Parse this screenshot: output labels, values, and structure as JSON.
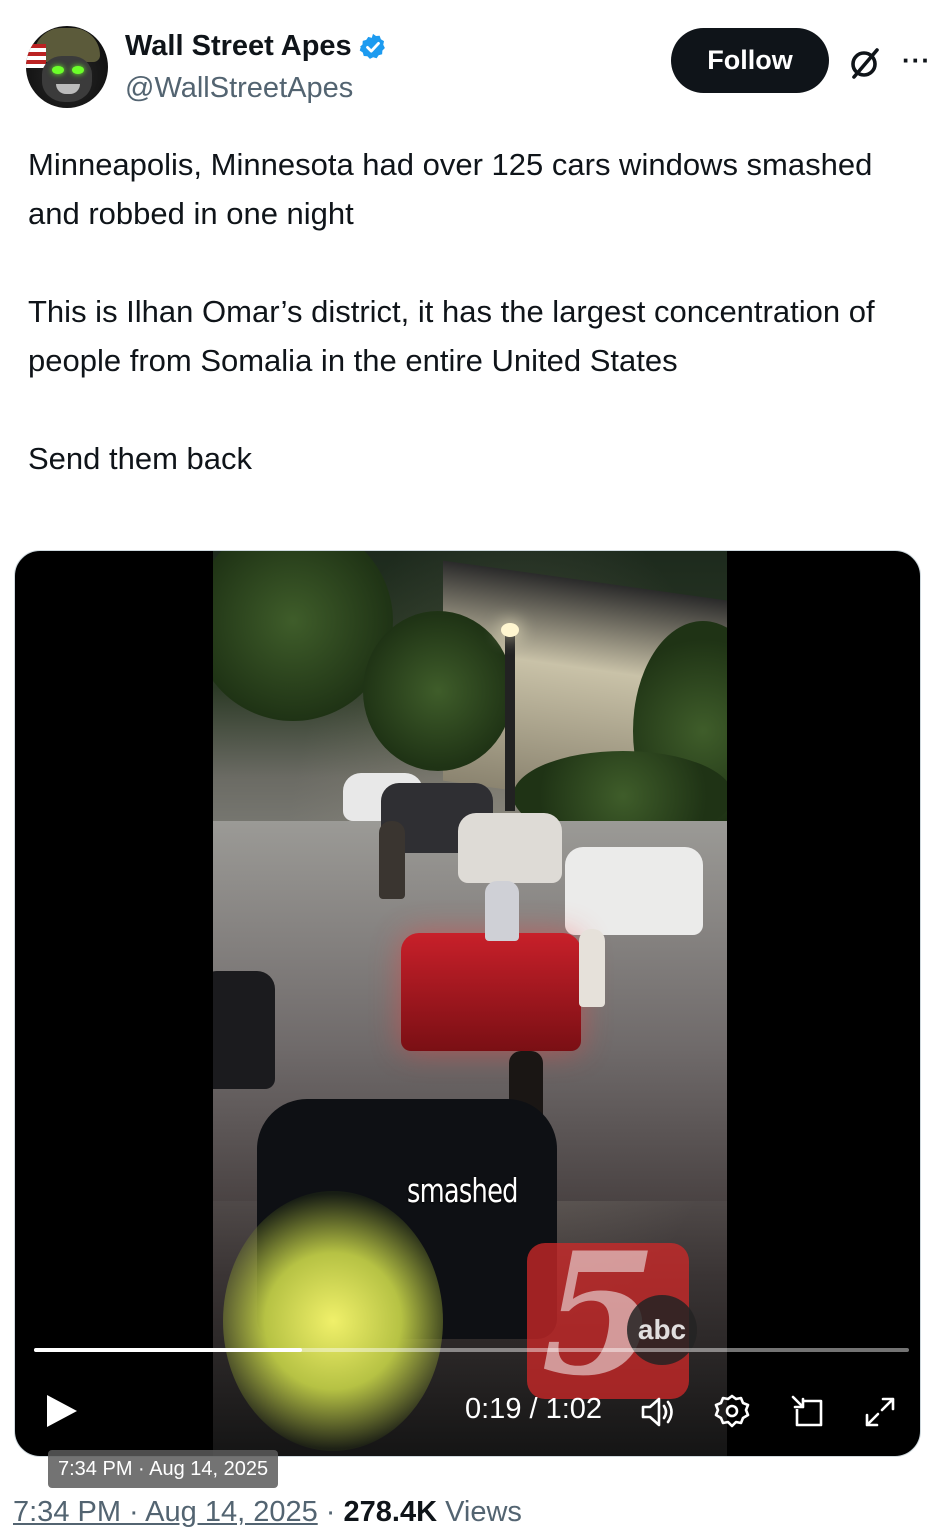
{
  "author": {
    "display_name": "Wall Street Apes",
    "handle": "@WallStreetApes",
    "verified": true,
    "verified_color": "#1d9bf0"
  },
  "actions": {
    "follow_label": "Follow",
    "grok_icon": "grok-icon",
    "more_icon": "more-icon",
    "more_label": "···"
  },
  "tweet": {
    "paragraphs": [
      "Minneapolis, Minnesota had over 125 cars windows smashed and robbed in one night",
      "This is Ilhan Omar’s district, it has the largest concentration of people from Somalia in the entire United States",
      "Send them back"
    ]
  },
  "video": {
    "caption": "smashed",
    "station_logo_number": "5",
    "station_logo_network": "abc",
    "current_time": "0:19",
    "duration": "1:02",
    "time_label": "0:19 / 1:02",
    "progress_fraction": 0.306,
    "overlay_timestamp": "7:34 PM · Aug 14, 2025",
    "controls": [
      "play-icon",
      "volume-icon",
      "settings-icon",
      "picture-in-picture-icon",
      "fullscreen-icon"
    ]
  },
  "meta": {
    "date": "7:34 PM · Aug 14, 2025",
    "separator": " · ",
    "views_count": "278.4K",
    "views_label": " Views"
  },
  "colors": {
    "text_primary": "#0f1419",
    "text_secondary": "#536471",
    "follow_button_bg": "#0f1419"
  }
}
